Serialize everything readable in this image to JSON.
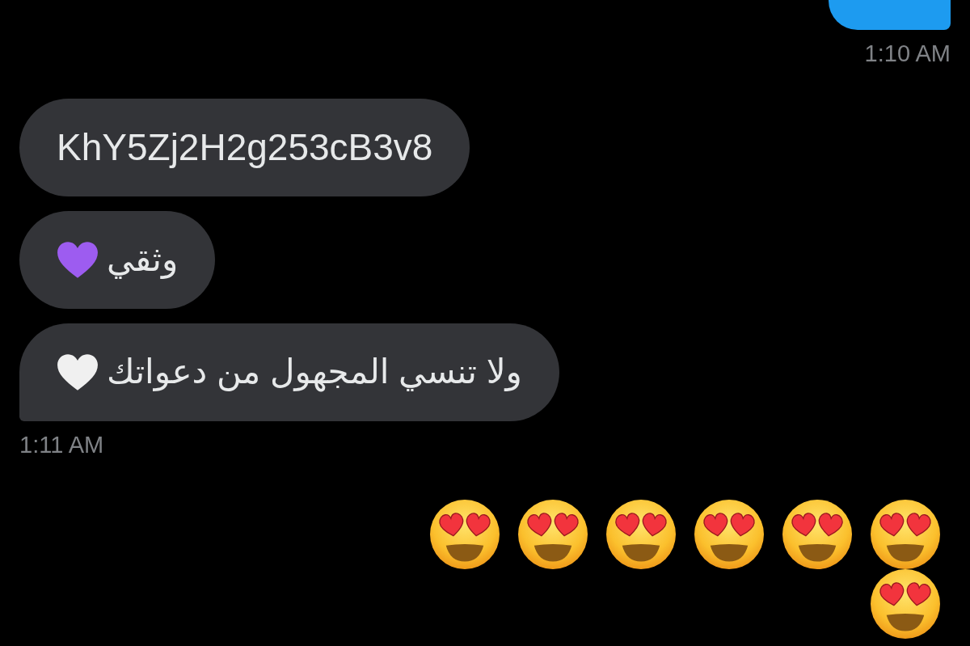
{
  "groups": [
    {
      "outgoing": true,
      "bubbles": [
        {
          "kind": "cropped"
        }
      ],
      "time": "1:10 AM"
    },
    {
      "outgoing": false,
      "bubbles": [
        {
          "kind": "text",
          "text": "KhY5Zj2H2g253cB3v8"
        },
        {
          "kind": "text",
          "text": "وثقي",
          "icon": {
            "kind": "heart",
            "color": "#9d5cf0"
          }
        },
        {
          "kind": "text",
          "text": "ولا تنسي المجهول من دعواتك",
          "icon": {
            "kind": "heart",
            "color": "#f0f0f0"
          }
        }
      ],
      "time": "1:11 AM"
    },
    {
      "outgoing": true,
      "bubbles": [
        {
          "kind": "emoji",
          "icons": [
            {
              "kind": "heart_eyes"
            },
            {
              "kind": "heart_eyes"
            },
            {
              "kind": "heart_eyes"
            },
            {
              "kind": "heart_eyes"
            },
            {
              "kind": "heart_eyes"
            },
            {
              "kind": "heart_eyes"
            },
            {
              "kind": "heart_eyes"
            }
          ]
        }
      ]
    }
  ]
}
